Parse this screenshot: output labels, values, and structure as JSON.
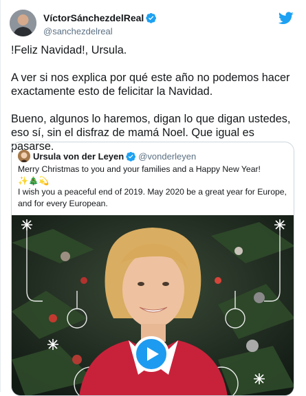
{
  "tweet": {
    "author": {
      "name": "VíctorSánchezdelReal",
      "handle": "@sanchezdelreal",
      "verified": true
    },
    "paragraphs": [
      "!Feliz Navidad!, Ursula.",
      "A ver si nos explica por qué este año no podemos hacer exactamente esto de felicitar la Navidad.",
      "Bueno, algunos lo haremos, digan lo que digan ustedes, eso sí, sin el disfraz de mamá Noel. Que igual es pasarse."
    ],
    "quote": {
      "author": {
        "name": "Ursula von der Leyen",
        "handle": "@vonderleyen",
        "verified": true
      },
      "text": "Merry Christmas to you and your families and a Happy New Year!\n✨🎄💫\nI wish you a peaceful end of 2019. May 2020 be a great year for Europe, and for every European.",
      "media": {
        "kind": "video",
        "icon": "play-icon"
      }
    }
  },
  "colors": {
    "brand": "#1da1f2",
    "text": "#14171a",
    "secondary": "#5b7083",
    "border": "#ccd6dd",
    "play": "#1d9bf0"
  }
}
